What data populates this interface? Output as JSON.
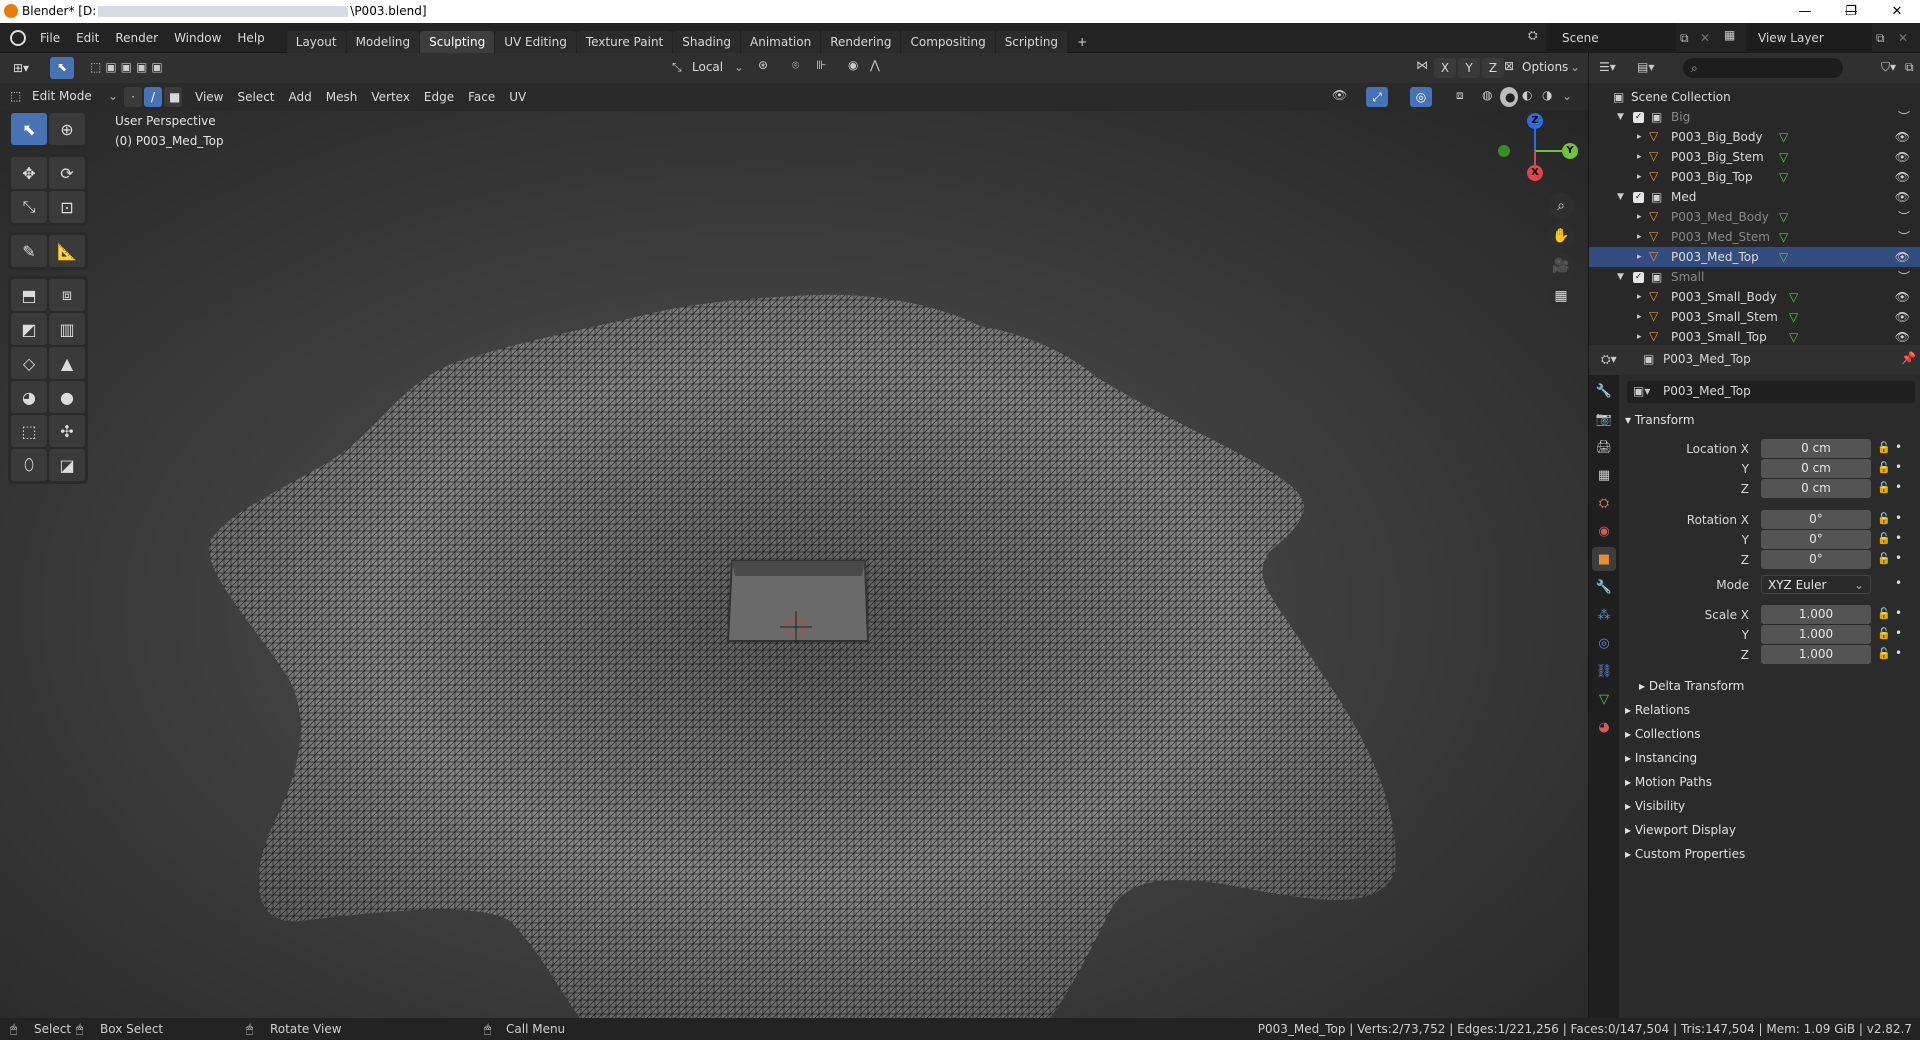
{
  "window": {
    "title_prefix": "Blender* [D:",
    "title_suffix": "\\P003.blend]",
    "min": "—",
    "max": "❐",
    "close": "✕"
  },
  "menu": {
    "items": [
      "File",
      "Edit",
      "Render",
      "Window",
      "Help"
    ],
    "tabs": [
      "Layout",
      "Modeling",
      "Sculpting",
      "UV Editing",
      "Texture Paint",
      "Shading",
      "Animation",
      "Rendering",
      "Compositing",
      "Scripting"
    ],
    "active_tab": "Sculpting",
    "add_tab": "+",
    "scene_label": "Scene",
    "view_layer_label": "View Layer"
  },
  "header1": {
    "orientation": "Local",
    "options": "Options",
    "axes": [
      "X",
      "Y",
      "Z"
    ]
  },
  "header2": {
    "mode": "Edit Mode",
    "menus": [
      "View",
      "Select",
      "Add",
      "Mesh",
      "Vertex",
      "Edge",
      "Face",
      "UV"
    ]
  },
  "viewport": {
    "perspective": "User Perspective",
    "object_label": "(0) P003_Med_Top",
    "gizmo": {
      "x": "X",
      "y": "Y",
      "z": "Z"
    }
  },
  "outliner": {
    "root": "Scene Collection",
    "collections": [
      {
        "name": "Big",
        "objects": [
          "P003_Big_Body",
          "P003_Big_Stem",
          "P003_Big_Top"
        ]
      },
      {
        "name": "Med",
        "objects": [
          "P003_Med_Body",
          "P003_Med_Stem",
          "P003_Med_Top"
        ]
      },
      {
        "name": "Small",
        "objects": [
          "P003_Small_Body",
          "P003_Small_Stem",
          "P003_Small_Top"
        ]
      }
    ],
    "selected_object": "P003_Med_Top"
  },
  "properties": {
    "header_object": "P003_Med_Top",
    "object_name": "P003_Med_Top",
    "transform_title": "Transform",
    "location": {
      "label": "Location X",
      "x": "0 cm",
      "y": "0 cm",
      "z": "0 cm"
    },
    "rotation": {
      "label": "Rotation X",
      "x": "0°",
      "y": "0°",
      "z": "0°"
    },
    "mode": {
      "label": "Mode",
      "value": "XYZ Euler"
    },
    "scale": {
      "label": "Scale X",
      "x": "1.000",
      "y": "1.000",
      "z": "1.000"
    },
    "axis_y": "Y",
    "axis_z": "Z",
    "delta": "Delta Transform",
    "sections": [
      "Relations",
      "Collections",
      "Instancing",
      "Motion Paths",
      "Visibility",
      "Viewport Display",
      "Custom Properties"
    ]
  },
  "status": {
    "select": "Select",
    "box_select": "Box Select",
    "rotate_view": "Rotate View",
    "call_menu": "Call Menu",
    "stats": "P003_Med_Top | Verts:2/73,752 | Edges:1/221,256 | Faces:0/147,504 | Tris:147,504 | Mem: 1.09 GiB | v2.82.7"
  }
}
